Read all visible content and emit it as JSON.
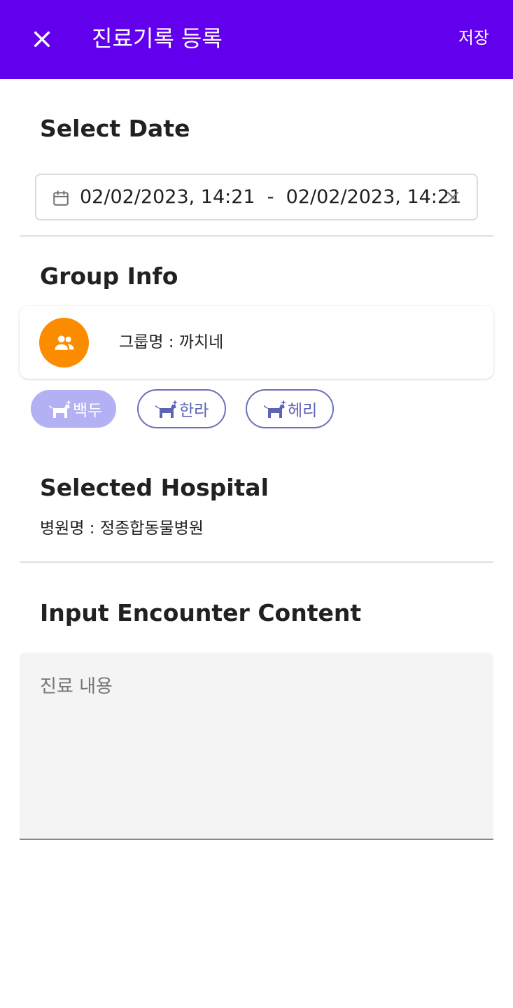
{
  "appbar": {
    "title": "진료기록 등록",
    "save_label": "저장",
    "color": "#6200ee"
  },
  "date_section": {
    "title": "Select Date",
    "range_text": "02/02/2023, 14:21  -  02/02/2023, 14:21"
  },
  "group_section": {
    "title": "Group Info",
    "group_name": "그룹명 : 까치네",
    "avatar_icon": "group-icon",
    "avatar_color": "#fb8c00"
  },
  "pets": [
    {
      "name": "백두",
      "selected": true
    },
    {
      "name": "한라",
      "selected": false
    },
    {
      "name": "헤리",
      "selected": false
    }
  ],
  "hospital_section": {
    "title": "Selected Hospital",
    "hospital_name": "병원명 : 정종합동물병원"
  },
  "content_section": {
    "title": "Input Encounter Content",
    "placeholder": "진료 내용",
    "value": ""
  }
}
